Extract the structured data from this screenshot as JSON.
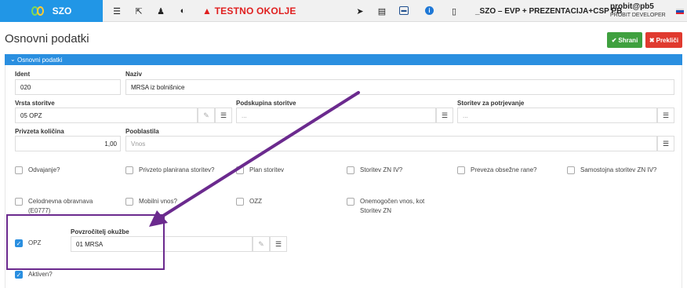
{
  "topbar": {
    "app_name": "SZO",
    "testno": "TESTNO OKOLJE",
    "environment": "_SZO – EVP + PREZENTACIJA+CSP PB",
    "user": "probit@pb5",
    "role": "PROBIT DEVELOPER",
    "icons": [
      "list-icon",
      "external-link-icon",
      "user-secret-icon",
      "contrast-icon",
      "warning-icon",
      "send-icon",
      "card-icon",
      "window-icon",
      "info-icon",
      "document-icon",
      "flag-si-icon"
    ]
  },
  "header": {
    "title": "Osnovni podatki",
    "save_label": "Shrani",
    "cancel_label": "Prekliči"
  },
  "panel": {
    "title": "Osnovni podatki"
  },
  "form": {
    "ident_label": "Ident",
    "ident_value": "020",
    "naziv_label": "Naziv",
    "naziv_value": "MRSA iz bolnišnice",
    "vrsta_label": "Vrsta storitve",
    "vrsta_value": "05 OPZ",
    "podskupina_label": "Podskupina storitve",
    "podskupina_placeholder": "...",
    "storitev_label": "Storitev za potrjevanje",
    "storitev_placeholder": "...",
    "kolicina_label": "Privzeta količina",
    "kolicina_value": "1,00",
    "pooblastila_label": "Pooblastila",
    "pooblastila_placeholder": "Vnos",
    "povzrocitelj_label": "Povzročitelj okužbe",
    "povzrocitelj_value": "01 MRSA"
  },
  "checkboxes": {
    "odvajanje": "Odvajanje?",
    "privzeto": "Privzeto planirana storitev?",
    "plan": "Plan storitev",
    "zniv": "Storitev ZN IV?",
    "preveza": "Preveza obsežne rane?",
    "samostojna": "Samostojna storitev ZN IV?",
    "celodnevna_1": "Celodnevna obravnava",
    "celodnevna_2": "(E0777)",
    "mobilni": "Mobilni vnos?",
    "ozz": "OZZ",
    "onemogocen_1": "Onemogočen vnos, kot",
    "onemogocen_2": "Storitev ZN",
    "opz": "OPZ",
    "aktiven": "Aktiven?"
  },
  "colors": {
    "accent": "#2a8fe0",
    "save": "#3fa03f",
    "cancel": "#e03a2f",
    "annotation": "#6b2a8e",
    "warning": "#e02020"
  }
}
